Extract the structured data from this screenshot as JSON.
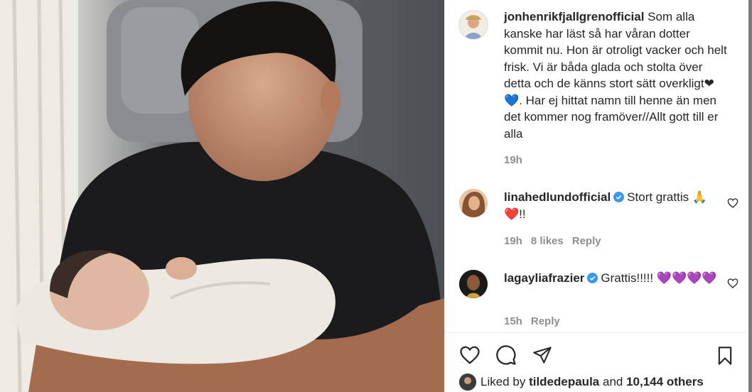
{
  "post": {
    "username": "jonhenrikfjallgrenofficial",
    "caption": "Som alla kanske har läst så har våran dotter kommit nu. Hon är otroligt vacker och helt frisk. Vi är båda glada och stolta över detta och de känns stort sätt overkligt❤💙. Har ej hittat namn till henne än men det kommer nog framöver//Allt gott till er alla",
    "time": "19h"
  },
  "comments": [
    {
      "username": "linahedlundofficial",
      "text": "Stort grattis 🙏❤️!!",
      "time": "19h",
      "likes": "8 likes",
      "reply": "Reply"
    },
    {
      "username": "lagayliafrazier",
      "text": "Grattis!!!!! 💜💜💜💜",
      "time": "15h",
      "reply": "Reply"
    }
  ],
  "actions": {
    "icons": [
      "heart-icon",
      "comment-icon",
      "share-icon",
      "bookmark-icon"
    ]
  },
  "likes_line": {
    "prefix": "Liked by",
    "user": "tildedepaula",
    "and": "and",
    "count": "10,144 others"
  }
}
